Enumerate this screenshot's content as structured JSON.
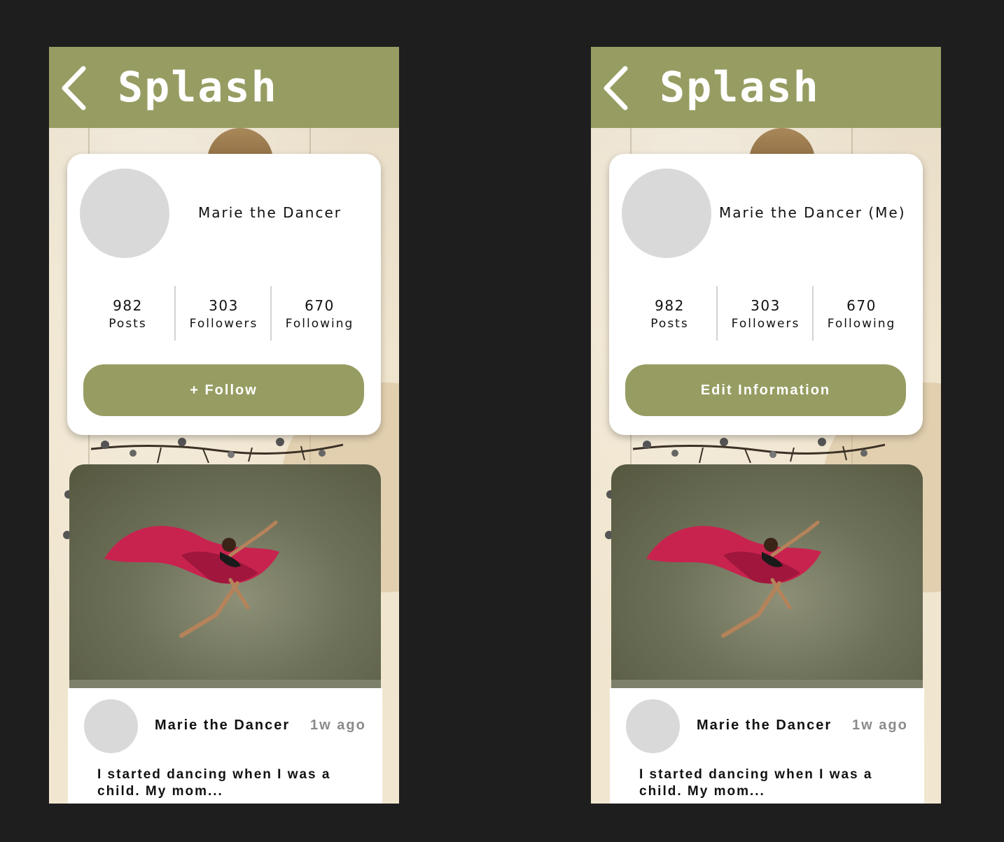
{
  "colors": {
    "canvas": "#1e1e1e",
    "accent": "#979d62",
    "card": "#ffffff",
    "placeholder": "#d9d9d9",
    "muted_text": "#8a8a8a"
  },
  "icons": {
    "back": "chevron-left-icon"
  },
  "screens": [
    {
      "header": {
        "title": "Splash"
      },
      "profile": {
        "name": "Marie the Dancer",
        "stats": [
          {
            "value": "982",
            "label": "Posts"
          },
          {
            "value": "303",
            "label": "Followers"
          },
          {
            "value": "670",
            "label": "Following"
          }
        ],
        "action_label": "+ Follow"
      },
      "post": {
        "author": "Marie the Dancer",
        "time": "1w ago",
        "text": "I started dancing when I was a child. My mom..."
      }
    },
    {
      "header": {
        "title": "Splash"
      },
      "profile": {
        "name": "Marie the Dancer (Me)",
        "stats": [
          {
            "value": "982",
            "label": "Posts"
          },
          {
            "value": "303",
            "label": "Followers"
          },
          {
            "value": "670",
            "label": "Following"
          }
        ],
        "action_label": "Edit Information"
      },
      "post": {
        "author": "Marie the Dancer",
        "time": "1w ago",
        "text": "I started dancing when I was a child. My mom..."
      }
    }
  ]
}
